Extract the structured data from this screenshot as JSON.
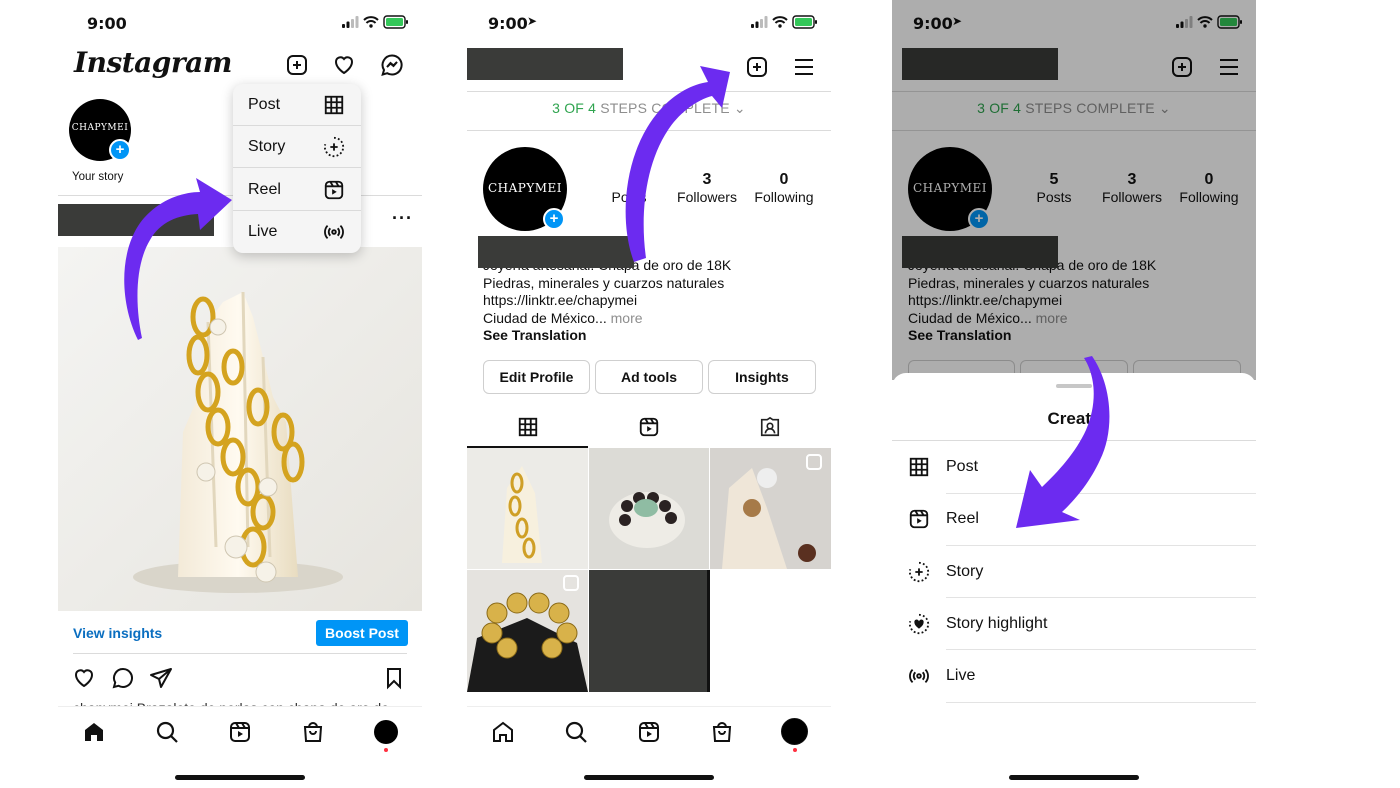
{
  "screens": [
    {
      "time": "9:00",
      "brand": "Instagram",
      "your_story": "Your story",
      "avatar_text": "CHAPYMEI",
      "menu": [
        {
          "label": "Post",
          "icon": "grid-icon"
        },
        {
          "label": "Story",
          "icon": "story-add-icon"
        },
        {
          "label": "Reel",
          "icon": "reel-icon"
        },
        {
          "label": "Live",
          "icon": "live-icon"
        }
      ],
      "view_insights": "View insights",
      "boost_post": "Boost Post",
      "caption": "chapymei Brazalete de perlas con chapa de oro de"
    },
    {
      "time": "9:00",
      "steps_count": "3 OF 4",
      "steps_label": "STEPS COMPLETE",
      "avatar_text": "CHAPYMEI",
      "stats": [
        {
          "value": "",
          "label": "Posts"
        },
        {
          "value": "3",
          "label": "Followers"
        },
        {
          "value": "0",
          "label": "Following"
        }
      ],
      "bio": {
        "line1": "Joyería artesanal. Chapa de oro de 18K",
        "line2": "Piedras, minerales y cuarzos naturales",
        "line3": "https://linktr.ee/chapymei",
        "line4": "Ciudad de México...",
        "more": "more",
        "translate": "See Translation"
      },
      "buttons": {
        "edit": "Edit Profile",
        "ad": "Ad tools",
        "insights": "Insights"
      }
    },
    {
      "time": "9:00",
      "steps_count": "3 OF 4",
      "steps_label": "STEPS COMPLETE",
      "avatar_text": "CHAPYMEI",
      "stats": [
        {
          "value": "5",
          "label": "Posts"
        },
        {
          "value": "3",
          "label": "Followers"
        },
        {
          "value": "0",
          "label": "Following"
        }
      ],
      "bio": {
        "line1": "Joyería artesanal. Chapa de oro de 18K",
        "line2": "Piedras, minerales y cuarzos naturales",
        "line3": "https://linktr.ee/chapymei",
        "line4": "Ciudad de México...",
        "more": "more",
        "translate": "See Translation"
      },
      "sheet": {
        "title": "Create",
        "items": [
          {
            "label": "Post",
            "icon": "grid-icon"
          },
          {
            "label": "Reel",
            "icon": "reel-icon"
          },
          {
            "label": "Story",
            "icon": "story-add-icon"
          },
          {
            "label": "Story highlight",
            "icon": "highlight-icon"
          },
          {
            "label": "Live",
            "icon": "live-icon"
          }
        ]
      }
    }
  ],
  "colors": {
    "accent_arrow": "#6c2bf0",
    "instagram_blue": "#0095f6",
    "steps_green": "#2fa44f"
  }
}
